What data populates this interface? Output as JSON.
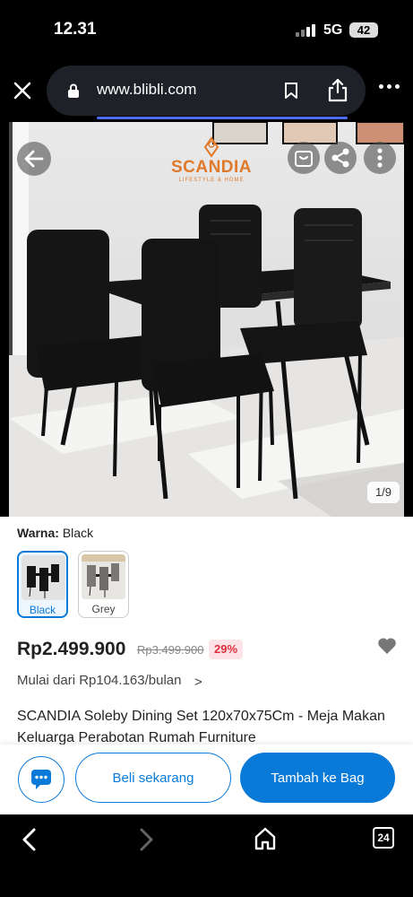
{
  "status_bar": {
    "time": "12.31",
    "network": "5G",
    "battery": "42"
  },
  "browser": {
    "url": "www.blibli.com",
    "close_icon": "close-icon",
    "lock_icon": "lock-icon",
    "bookmark_icon": "bookmark-icon",
    "share_icon": "share-icon",
    "more_icon": "more-vertical-dots-icon"
  },
  "gallery": {
    "brand_logo": "SCANDIA",
    "brand_tagline": "LIFESTYLE & HOME",
    "counter": "1/9"
  },
  "variant": {
    "label": "Warna:",
    "selected": "Black",
    "options": [
      {
        "label": "Black",
        "selected": true
      },
      {
        "label": "Grey",
        "selected": false
      }
    ]
  },
  "pricing": {
    "price": "Rp2.499.900",
    "original_price": "Rp3.499.900",
    "discount": "29%",
    "installment": "Mulai dari Rp104.163/bulan",
    "installment_chevron": ">"
  },
  "product": {
    "title": "SCANDIA Soleby Dining Set 120x70x75Cm - Meja Makan Keluarga Perabotan Rumah Furniture"
  },
  "actions": {
    "buy_now": "Beli sekarang",
    "add_to_bag": "Tambah ke Bag"
  },
  "browser_nav": {
    "tabs_count": "24"
  },
  "colors": {
    "accent": "#0a7ad8",
    "discount": "#e0303b",
    "logo": "#e07a2a"
  }
}
